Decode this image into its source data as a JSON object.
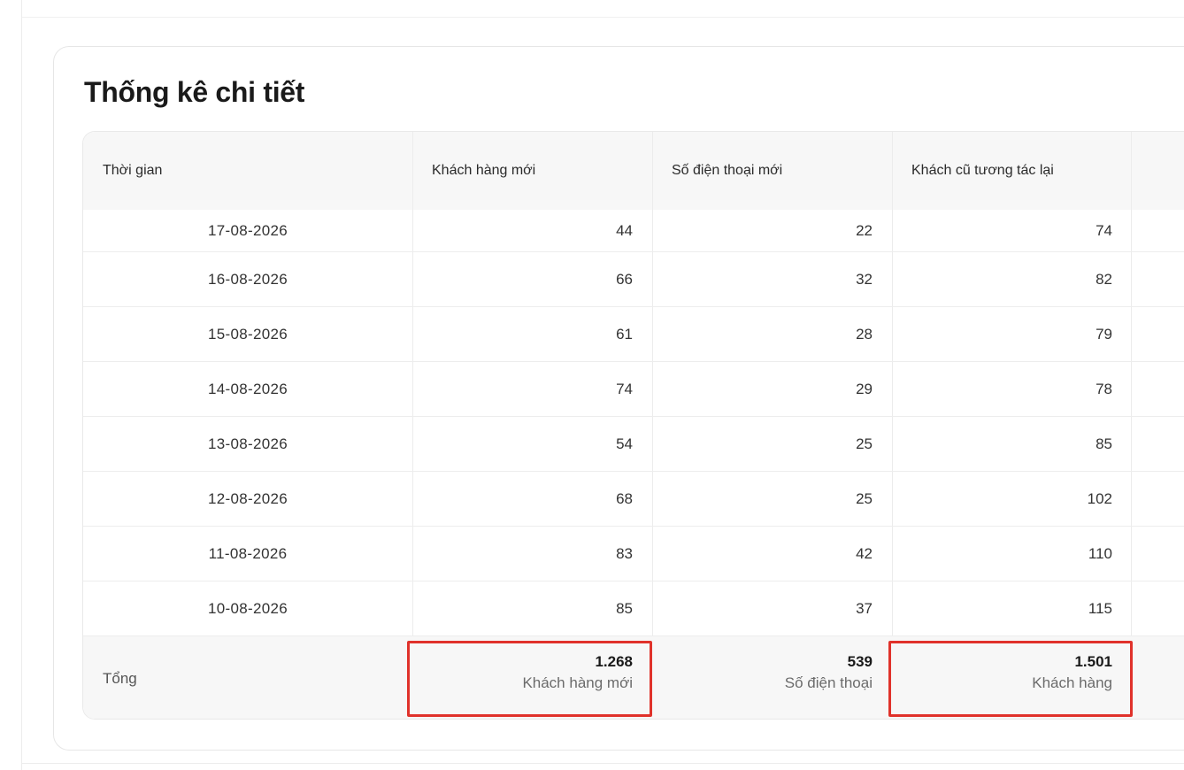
{
  "section_title": "Thống kê chi tiết",
  "columns": [
    "Thời gian",
    "Khách hàng mới",
    "Số điện thoại mới",
    "Khách cũ tương tác lại"
  ],
  "rows": [
    {
      "date": "17-08-2026",
      "new_customers": "44",
      "new_phones": "22",
      "returning": "74"
    },
    {
      "date": "16-08-2026",
      "new_customers": "66",
      "new_phones": "32",
      "returning": "82"
    },
    {
      "date": "15-08-2026",
      "new_customers": "61",
      "new_phones": "28",
      "returning": "79"
    },
    {
      "date": "14-08-2026",
      "new_customers": "74",
      "new_phones": "29",
      "returning": "78"
    },
    {
      "date": "13-08-2026",
      "new_customers": "54",
      "new_phones": "25",
      "returning": "85"
    },
    {
      "date": "12-08-2026",
      "new_customers": "68",
      "new_phones": "25",
      "returning": "102"
    },
    {
      "date": "11-08-2026",
      "new_customers": "83",
      "new_phones": "42",
      "returning": "110"
    },
    {
      "date": "10-08-2026",
      "new_customers": "85",
      "new_phones": "37",
      "returning": "115"
    }
  ],
  "total": {
    "label": "Tổng",
    "new_customers": {
      "value": "1.268",
      "sub": "Khách hàng mới"
    },
    "new_phones": {
      "value": "539",
      "sub": "Số điện thoại"
    },
    "returning": {
      "value": "1.501",
      "sub": "Khách hàng"
    }
  },
  "highlight_color": "#e0322b"
}
